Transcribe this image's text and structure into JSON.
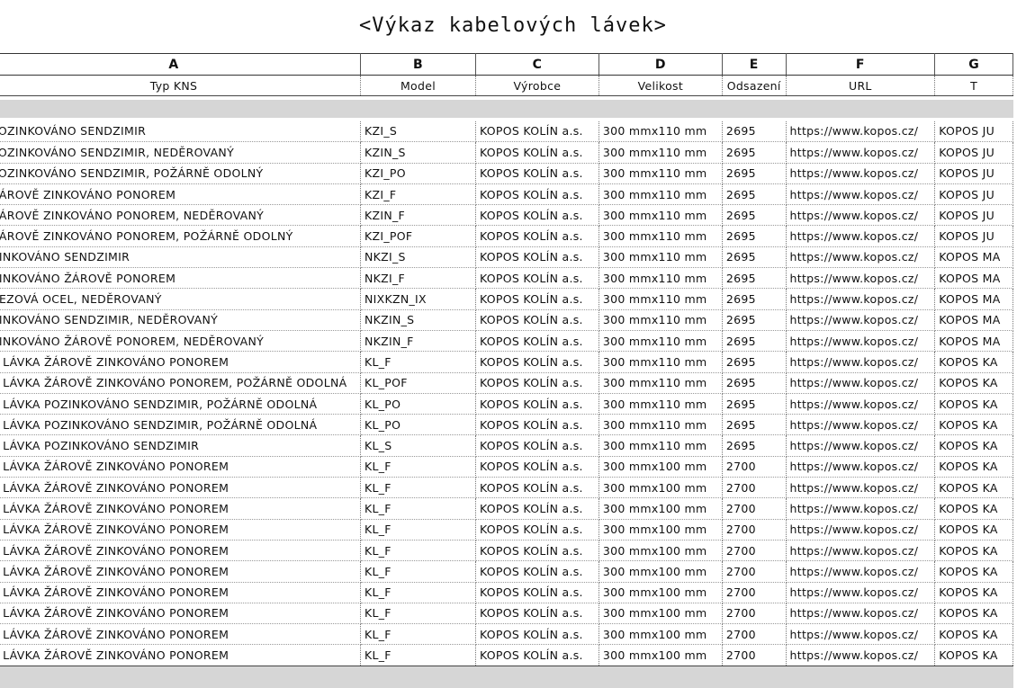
{
  "title": "<Výkaz kabelových lávek>",
  "column_letters": [
    "A",
    "B",
    "C",
    "D",
    "E",
    "F",
    "G"
  ],
  "column_headers": [
    "Typ KNS",
    "Model",
    "Výrobce",
    "Velikost",
    "Odsazení",
    "URL",
    "T"
  ],
  "rows": [
    [
      "POZINKOVÁNO SENDZIMIR",
      "KZI_S",
      "KOPOS KOLÍN a.s.",
      "300 mmx110 mm",
      "2695",
      "https://www.kopos.cz/",
      "KOPOS JU"
    ],
    [
      "POZINKOVÁNO SENDZIMIR, NEDĚROVANÝ",
      "KZIN_S",
      "KOPOS KOLÍN a.s.",
      "300 mmx110 mm",
      "2695",
      "https://www.kopos.cz/",
      "KOPOS JU"
    ],
    [
      "POZINKOVÁNO SENDZIMIR, POŽÁRNĚ ODOLNÝ",
      "KZI_PO",
      "KOPOS KOLÍN a.s.",
      "300 mmx110 mm",
      "2695",
      "https://www.kopos.cz/",
      "KOPOS JU"
    ],
    [
      "ŽÁROVĚ ZINKOVÁNO PONOREM",
      "KZI_F",
      "KOPOS KOLÍN a.s.",
      "300 mmx110 mm",
      "2695",
      "https://www.kopos.cz/",
      "KOPOS JU"
    ],
    [
      "ŽÁROVĚ ZINKOVÁNO PONOREM, NEDĚROVANÝ",
      "KZIN_F",
      "KOPOS KOLÍN a.s.",
      "300 mmx110 mm",
      "2695",
      "https://www.kopos.cz/",
      "KOPOS JU"
    ],
    [
      "ŽÁROVĚ ZINKOVÁNO PONOREM, POŽÁRNĚ ODOLNÝ",
      "KZI_POF",
      "KOPOS KOLÍN a.s.",
      "300 mmx110 mm",
      "2695",
      "https://www.kopos.cz/",
      "KOPOS JU"
    ],
    [
      "ZINKOVÁNO SENDZIMIR",
      "NKZI_S",
      "KOPOS KOLÍN a.s.",
      "300 mmx110 mm",
      "2695",
      "https://www.kopos.cz/",
      "KOPOS MA"
    ],
    [
      "ZINKOVÁNO ŽÁROVĚ PONOREM",
      "NKZI_F",
      "KOPOS KOLÍN a.s.",
      "300 mmx110 mm",
      "2695",
      "https://www.kopos.cz/",
      "KOPOS MA"
    ],
    [
      "REZOVÁ OCEL, NEDĚROVANÝ",
      "NIXKZN_IX",
      "KOPOS KOLÍN a.s.",
      "300 mmx110 mm",
      "2695",
      "https://www.kopos.cz/",
      "KOPOS MA"
    ],
    [
      "ZINKOVÁNO SENDZIMIR, NEDĚROVANÝ",
      "NKZIN_S",
      "KOPOS KOLÍN a.s.",
      "300 mmx110 mm",
      "2695",
      "https://www.kopos.cz/",
      "KOPOS MA"
    ],
    [
      "ZINKOVÁNO ŽÁROVĚ PONOREM, NEDĚROVANÝ",
      "NKZIN_F",
      "KOPOS KOLÍN a.s.",
      "300 mmx110 mm",
      "2695",
      "https://www.kopos.cz/",
      "KOPOS MA"
    ],
    [
      "Á LÁVKA ŽÁROVĚ ZINKOVÁNO PONOREM",
      "KL_F",
      "KOPOS KOLÍN a.s.",
      "300 mmx110 mm",
      "2695",
      "https://www.kopos.cz/",
      "KOPOS KA"
    ],
    [
      "Á LÁVKA ŽÁROVĚ ZINKOVÁNO PONOREM, POŽÁRNĚ ODOLNÁ",
      "KL_POF",
      "KOPOS KOLÍN a.s.",
      "300 mmx110 mm",
      "2695",
      "https://www.kopos.cz/",
      "KOPOS KA"
    ],
    [
      "Á LÁVKA POZINKOVÁNO SENDZIMIR, POŽÁRNĚ ODOLNÁ",
      "KL_PO",
      "KOPOS KOLÍN a.s.",
      "300 mmx110 mm",
      "2695",
      "https://www.kopos.cz/",
      "KOPOS KA"
    ],
    [
      "Á LÁVKA POZINKOVÁNO SENDZIMIR, POŽÁRNĚ ODOLNÁ",
      "KL_PO",
      "KOPOS KOLÍN a.s.",
      "300 mmx110 mm",
      "2695",
      "https://www.kopos.cz/",
      "KOPOS KA"
    ],
    [
      "Á LÁVKA POZINKOVÁNO SENDZIMIR",
      "KL_S",
      "KOPOS KOLÍN a.s.",
      "300 mmx110 mm",
      "2695",
      "https://www.kopos.cz/",
      "KOPOS KA"
    ],
    [
      "Á LÁVKA ŽÁROVĚ ZINKOVÁNO PONOREM",
      "KL_F",
      "KOPOS KOLÍN a.s.",
      "300 mmx100 mm",
      "2700",
      "https://www.kopos.cz/",
      "KOPOS KA"
    ],
    [
      "Á LÁVKA ŽÁROVĚ ZINKOVÁNO PONOREM",
      "KL_F",
      "KOPOS KOLÍN a.s.",
      "300 mmx100 mm",
      "2700",
      "https://www.kopos.cz/",
      "KOPOS KA"
    ],
    [
      "Á LÁVKA ŽÁROVĚ ZINKOVÁNO PONOREM",
      "KL_F",
      "KOPOS KOLÍN a.s.",
      "300 mmx100 mm",
      "2700",
      "https://www.kopos.cz/",
      "KOPOS KA"
    ],
    [
      "Á LÁVKA ŽÁROVĚ ZINKOVÁNO PONOREM",
      "KL_F",
      "KOPOS KOLÍN a.s.",
      "300 mmx100 mm",
      "2700",
      "https://www.kopos.cz/",
      "KOPOS KA"
    ],
    [
      "Á LÁVKA ŽÁROVĚ ZINKOVÁNO PONOREM",
      "KL_F",
      "KOPOS KOLÍN a.s.",
      "300 mmx100 mm",
      "2700",
      "https://www.kopos.cz/",
      "KOPOS KA"
    ],
    [
      "Á LÁVKA ŽÁROVĚ ZINKOVÁNO PONOREM",
      "KL_F",
      "KOPOS KOLÍN a.s.",
      "300 mmx100 mm",
      "2700",
      "https://www.kopos.cz/",
      "KOPOS KA"
    ],
    [
      "Á LÁVKA ŽÁROVĚ ZINKOVÁNO PONOREM",
      "KL_F",
      "KOPOS KOLÍN a.s.",
      "300 mmx100 mm",
      "2700",
      "https://www.kopos.cz/",
      "KOPOS KA"
    ],
    [
      "Á LÁVKA ŽÁROVĚ ZINKOVÁNO PONOREM",
      "KL_F",
      "KOPOS KOLÍN a.s.",
      "300 mmx100 mm",
      "2700",
      "https://www.kopos.cz/",
      "KOPOS KA"
    ],
    [
      "Á LÁVKA ŽÁROVĚ ZINKOVÁNO PONOREM",
      "KL_F",
      "KOPOS KOLÍN a.s.",
      "300 mmx100 mm",
      "2700",
      "https://www.kopos.cz/",
      "KOPOS KA"
    ],
    [
      "Á LÁVKA ŽÁROVĚ ZINKOVÁNO PONOREM",
      "KL_F",
      "KOPOS KOLÍN a.s.",
      "300 mmx100 mm",
      "2700",
      "https://www.kopos.cz/",
      "KOPOS KA"
    ]
  ],
  "footer_count": "6",
  "colors": {
    "group_bar": "#d6d6d6",
    "background": "#ffffff",
    "text": "#111111"
  }
}
